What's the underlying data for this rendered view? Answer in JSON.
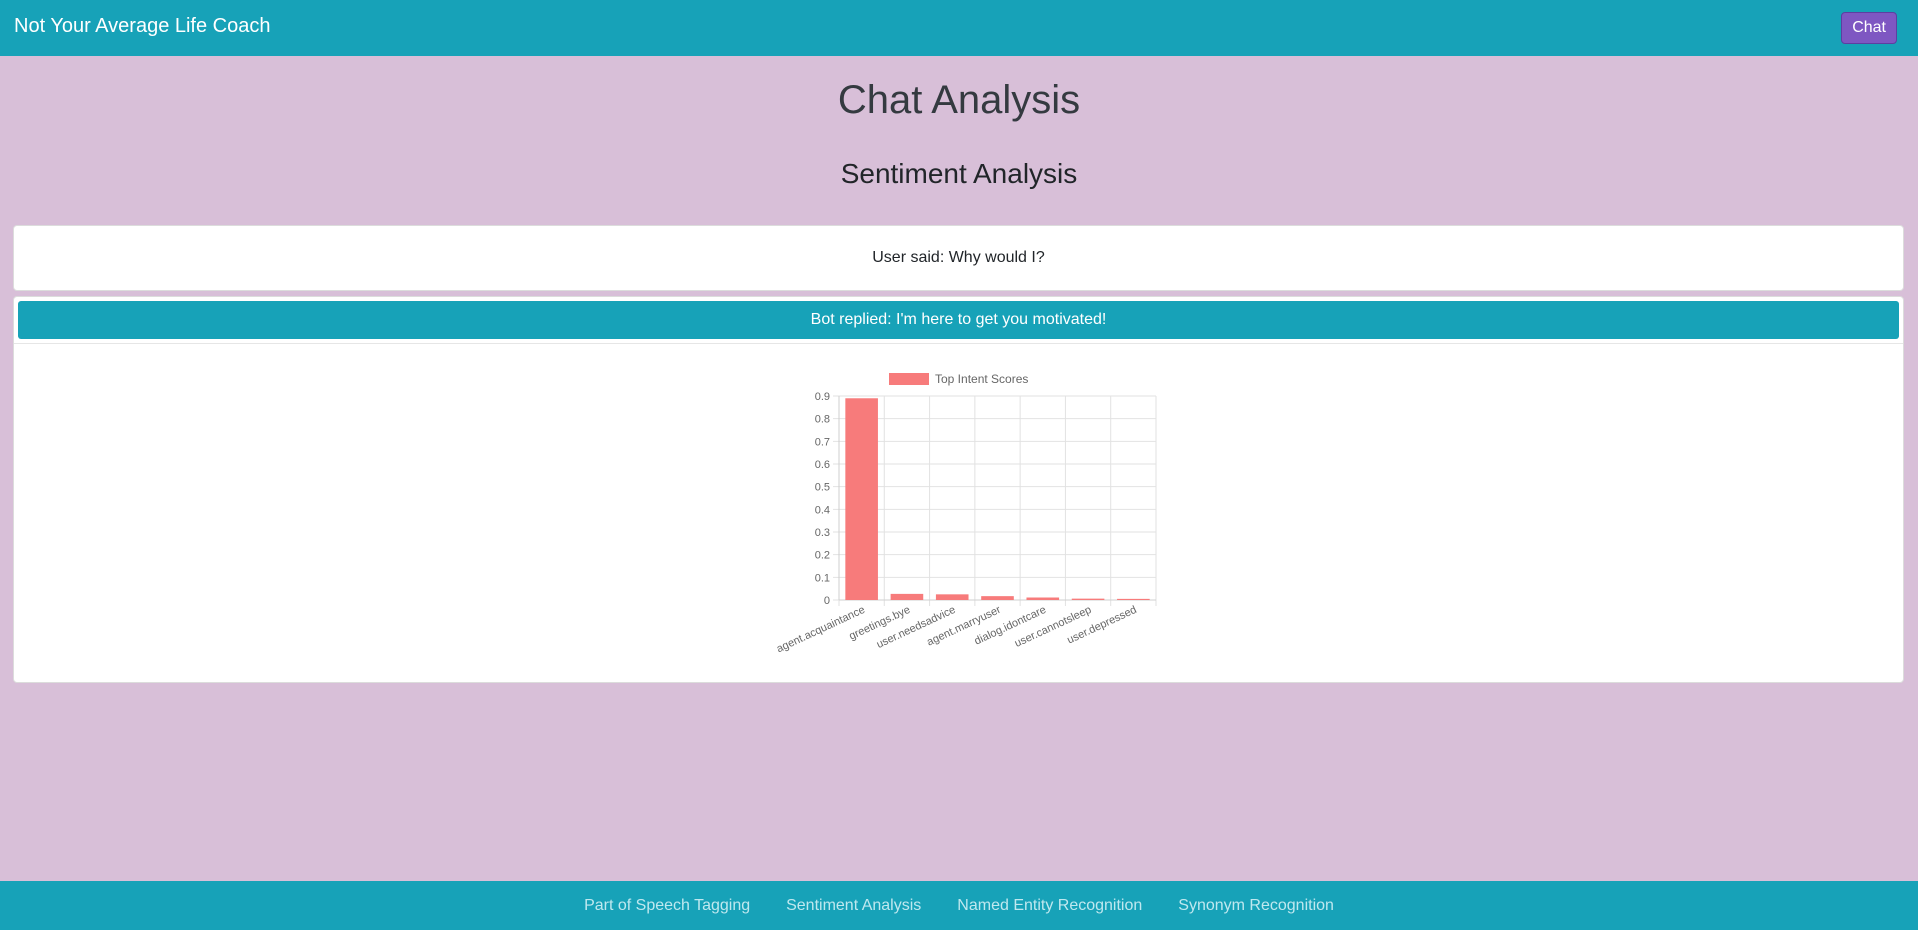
{
  "navbar": {
    "brand": "Not Your Average Life Coach",
    "chat_button": "Chat"
  },
  "main": {
    "title": "Chat Analysis",
    "section_title": "Sentiment Analysis",
    "user_message": "User said: Why would I?",
    "bot_reply": "Bot replied: I'm here to get you motivated!"
  },
  "chart_data": {
    "type": "bar",
    "title": "",
    "xlabel": "",
    "ylabel": "",
    "legend": "top-center",
    "categories": [
      "agent.acquaintance",
      "greetings.bye",
      "user.needsadvice",
      "agent.marryuser",
      "dialog.idontcare",
      "user.cannotsleep",
      "user.depressed"
    ],
    "series": [
      {
        "name": "Top Intent Scores",
        "values": [
          0.89,
          0.027,
          0.025,
          0.017,
          0.011,
          0.006,
          0.005
        ],
        "color": "#f77b7b"
      }
    ],
    "ylim": [
      0,
      0.9
    ],
    "yticks": [
      "0",
      "0.1",
      "0.2",
      "0.3",
      "0.4",
      "0.5",
      "0.6",
      "0.7",
      "0.8",
      "0.9"
    ],
    "grid": true
  },
  "footer": {
    "links": [
      "Part of Speech Tagging",
      "Sentiment Analysis",
      "Named Entity Recognition",
      "Synonym Recognition"
    ]
  },
  "colors": {
    "primary": "#17a2b8",
    "background": "#d8bfd8",
    "accent": "#7e57c2",
    "bar": "#f77b7b"
  }
}
